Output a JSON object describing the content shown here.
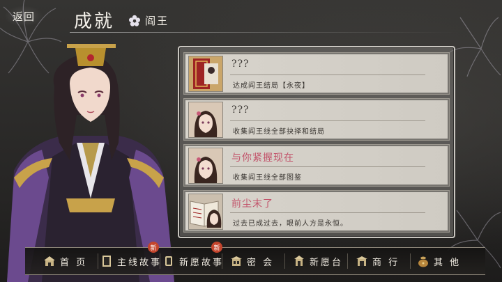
{
  "header": {
    "back_label": "返回",
    "title": "成就",
    "subtitle": "阎王"
  },
  "achievements": [
    {
      "name": "???",
      "description": "达成阎王结局【永夜】",
      "thumb": "book-icon",
      "unlocked": false
    },
    {
      "name": "???",
      "description": "收集阎王线全部抉择和结局",
      "thumb": "girl-portrait-icon",
      "unlocked": false
    },
    {
      "name": "与你紧握现在",
      "description": "收集阎王线全部图鉴",
      "thumb": "girl-portrait-icon",
      "unlocked": true
    },
    {
      "name": "前尘末了",
      "description": "过去已成过去，眼前人方是永恒。",
      "thumb": "book-girl-icon",
      "unlocked": true
    }
  ],
  "nav": {
    "items": [
      {
        "label": "首 页",
        "icon": "house-icon",
        "badge": ""
      },
      {
        "label": "主线故事",
        "icon": "book-icon",
        "badge": "新"
      },
      {
        "label": "新愿故事",
        "icon": "scroll-icon",
        "badge": "新"
      },
      {
        "label": "密 会",
        "icon": "pavilion-icon",
        "badge": ""
      },
      {
        "label": "新愿台",
        "icon": "shrine-icon",
        "badge": ""
      },
      {
        "label": "商 行",
        "icon": "shop-icon",
        "badge": ""
      },
      {
        "label": "其 他",
        "icon": "pouch-icon",
        "badge": ""
      }
    ]
  },
  "colors": {
    "accent_pink": "#c2536a",
    "badge_red": "#c4452d",
    "panel_border": "#c9c6c0"
  }
}
